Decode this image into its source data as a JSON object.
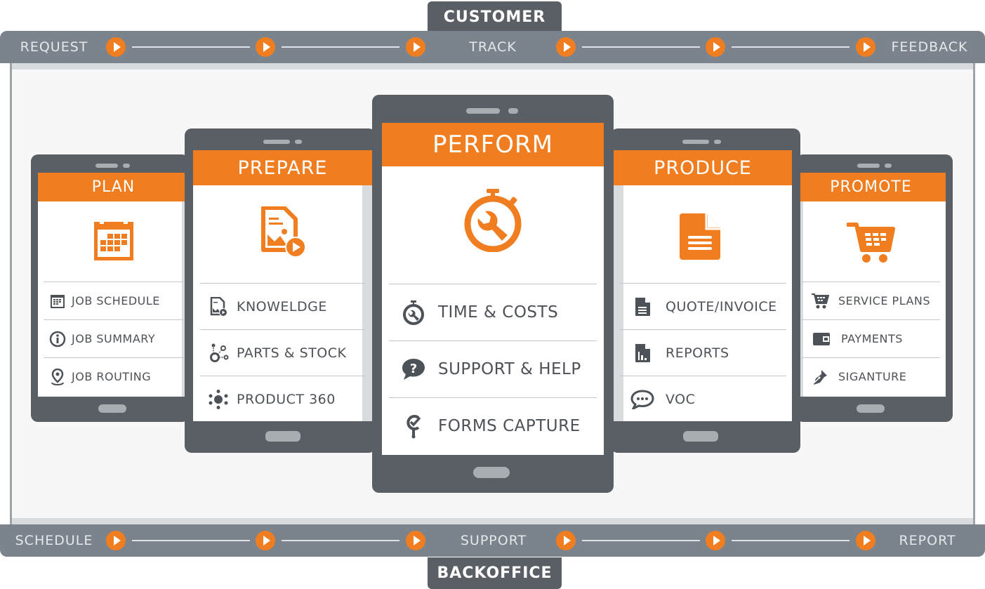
{
  "header_tab": {
    "label": "CUSTOMER"
  },
  "footer_tab": {
    "label": "BACKOFFICE"
  },
  "colors": {
    "accent": "#f07d1f",
    "phone_body": "#5a5f65",
    "flow_bar": "#7b838c",
    "item_text": "#4d5258"
  },
  "customer_flow": {
    "stages": [
      {
        "label": "REQUEST"
      },
      {
        "label": "TRACK"
      },
      {
        "label": "FEEDBACK"
      }
    ],
    "arrow_icon": "play-arrow-icon"
  },
  "backoffice_flow": {
    "stages": [
      {
        "label": "SCHEDULE"
      },
      {
        "label": "SUPPORT"
      },
      {
        "label": "REPORT"
      }
    ],
    "arrow_icon": "play-arrow-icon"
  },
  "phones": {
    "plan": {
      "title": "PLAN",
      "hero_icon": "calendar-icon",
      "items": [
        {
          "label": "JOB SCHEDULE",
          "icon": "calendar-icon"
        },
        {
          "label": "JOB SUMMARY",
          "icon": "info-icon"
        },
        {
          "label": "JOB ROUTING",
          "icon": "location-pin-icon"
        }
      ]
    },
    "prepare": {
      "title": "PREPARE",
      "hero_icon": "media-document-icon",
      "items": [
        {
          "label": "KNOWELDGE",
          "icon": "media-document-icon"
        },
        {
          "label": "PARTS & STOCK",
          "icon": "parts-network-icon"
        },
        {
          "label": "PRODUCT 360",
          "icon": "product-360-icon"
        }
      ]
    },
    "perform": {
      "title": "PERFORM",
      "hero_icon": "stopwatch-wrench-icon",
      "items": [
        {
          "label": "TIME & COSTS",
          "icon": "stopwatch-wrench-icon"
        },
        {
          "label": "SUPPORT & HELP",
          "icon": "question-bubble-icon"
        },
        {
          "label": "FORMS CAPTURE",
          "icon": "forms-check-icon"
        }
      ]
    },
    "produce": {
      "title": "PRODUCE",
      "hero_icon": "document-icon",
      "items": [
        {
          "label": "QUOTE/INVOICE",
          "icon": "document-icon"
        },
        {
          "label": "REPORTS",
          "icon": "report-chart-icon"
        },
        {
          "label": "VOC",
          "icon": "chat-bubble-icon"
        }
      ]
    },
    "promote": {
      "title": "PROMOTE",
      "hero_icon": "shopping-cart-icon",
      "items": [
        {
          "label": "SERVICE PLANS",
          "icon": "shopping-cart-icon"
        },
        {
          "label": "PAYMENTS",
          "icon": "wallet-icon"
        },
        {
          "label": "SIGANTURE",
          "icon": "pen-nib-icon"
        }
      ]
    }
  }
}
